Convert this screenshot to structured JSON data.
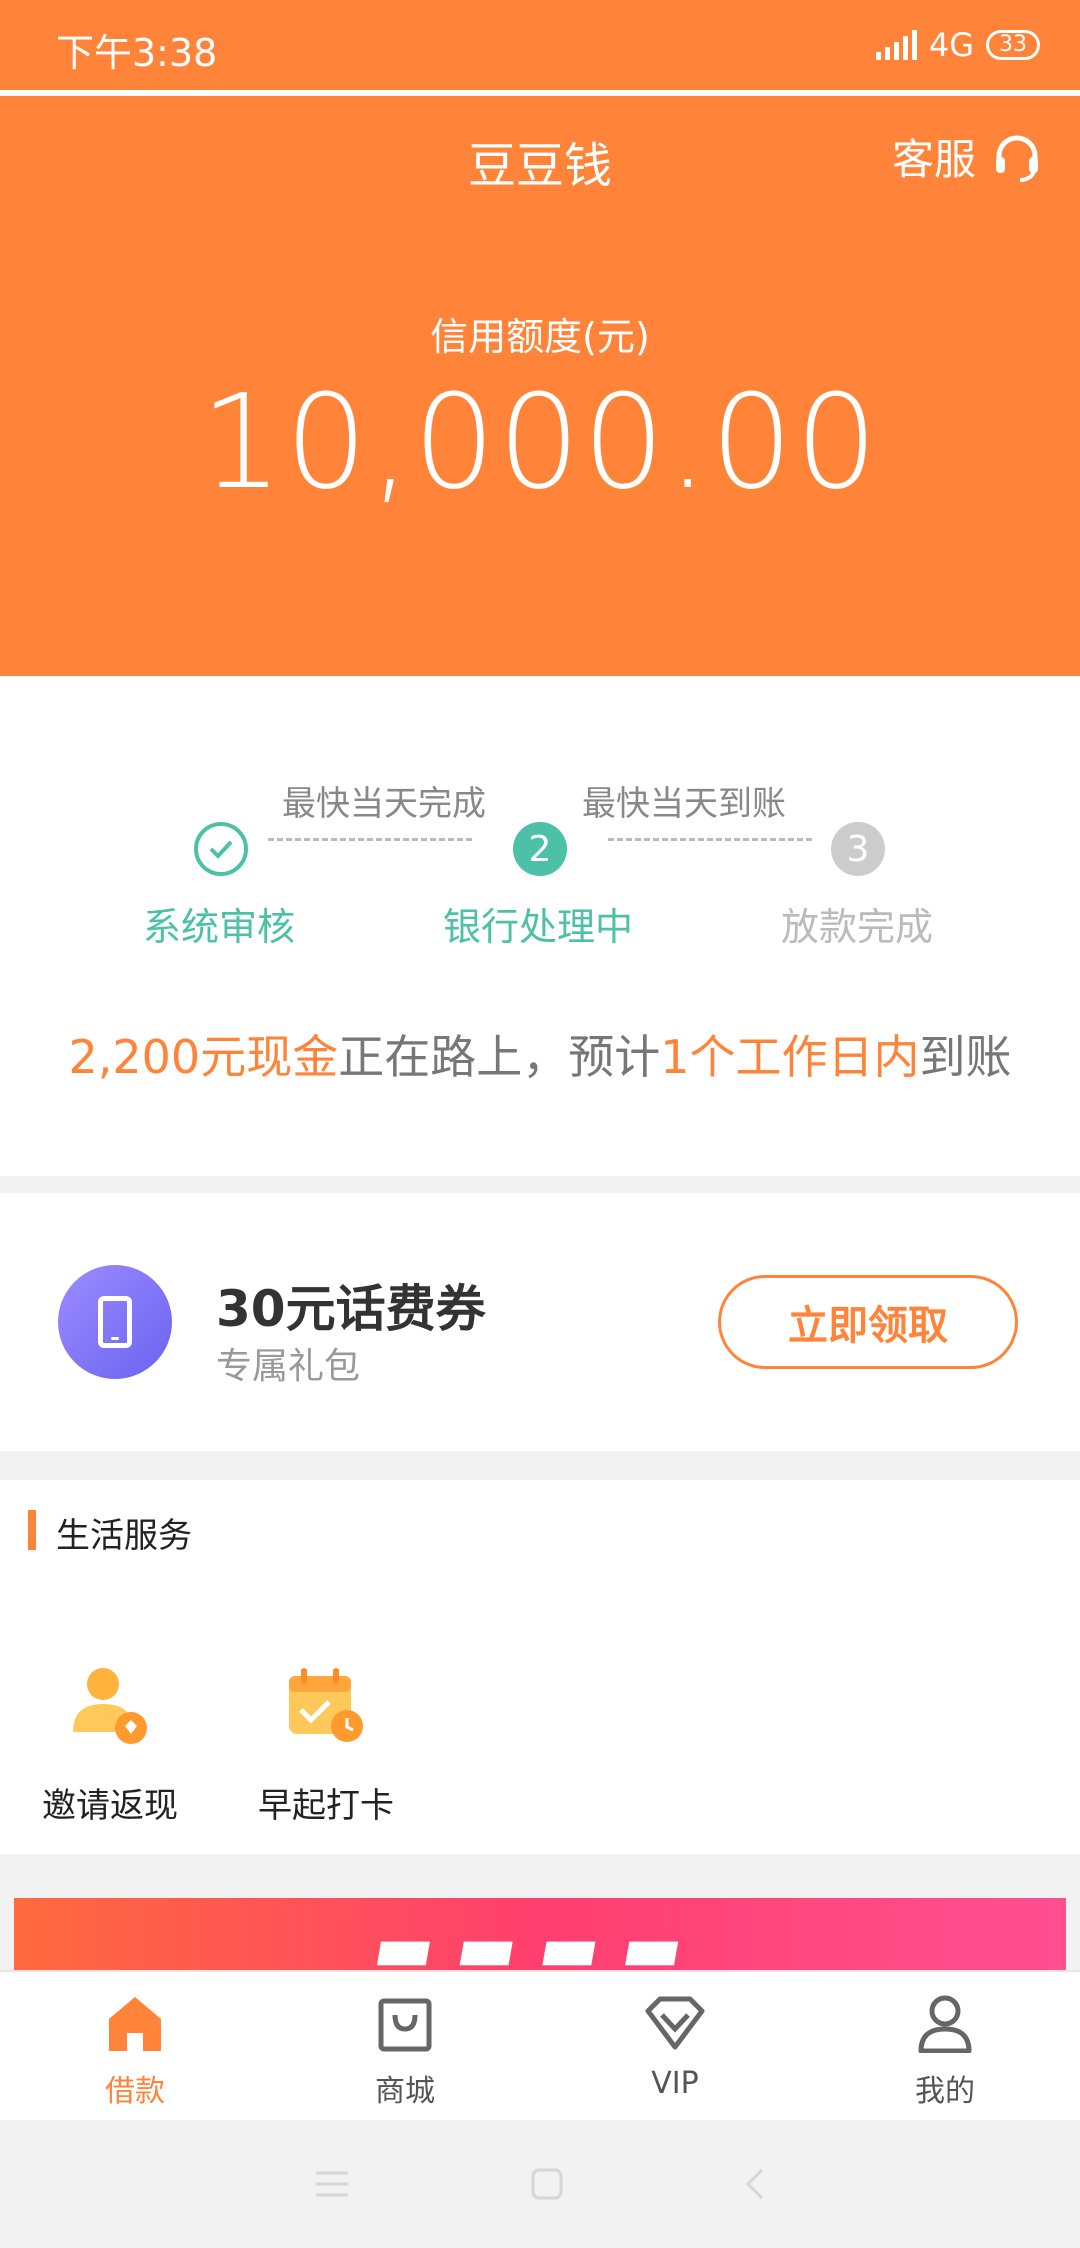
{
  "status_bar": {
    "time": "下午3:38",
    "network": "4G",
    "battery": "33"
  },
  "header": {
    "title": "豆豆钱",
    "service_label": "客服",
    "credit_label": "信用额度(元)",
    "credit_amount": "10,000.00"
  },
  "progress": {
    "hints": [
      "最快当天完成",
      "最快当天到账"
    ],
    "steps": [
      {
        "label": "系统审核",
        "state": "done"
      },
      {
        "label": "银行处理中",
        "number": "2",
        "state": "active"
      },
      {
        "label": "放款完成",
        "number": "3",
        "state": "pending"
      }
    ],
    "message": {
      "amount": "2,200元现金",
      "middle": "正在路上，预计",
      "time": "1个工作日内",
      "end": "到账"
    }
  },
  "coupon": {
    "title": "30元话费券",
    "subtitle": "专属礼包",
    "button": "立即领取"
  },
  "life_services": {
    "title": "生活服务",
    "items": [
      {
        "label": "邀请返现",
        "icon": "invite-cashback-icon"
      },
      {
        "label": "早起打卡",
        "icon": "early-checkin-icon"
      }
    ]
  },
  "tabs": [
    {
      "label": "借款",
      "icon": "home-icon",
      "active": true
    },
    {
      "label": "商城",
      "icon": "shopping-bag-icon",
      "active": false
    },
    {
      "label": "VIP",
      "icon": "diamond-icon",
      "active": false
    },
    {
      "label": "我的",
      "icon": "user-icon",
      "active": false
    }
  ],
  "colors": {
    "accent": "#ff843a",
    "teal": "#4cc1a7",
    "gray_step": "#cccccc"
  }
}
